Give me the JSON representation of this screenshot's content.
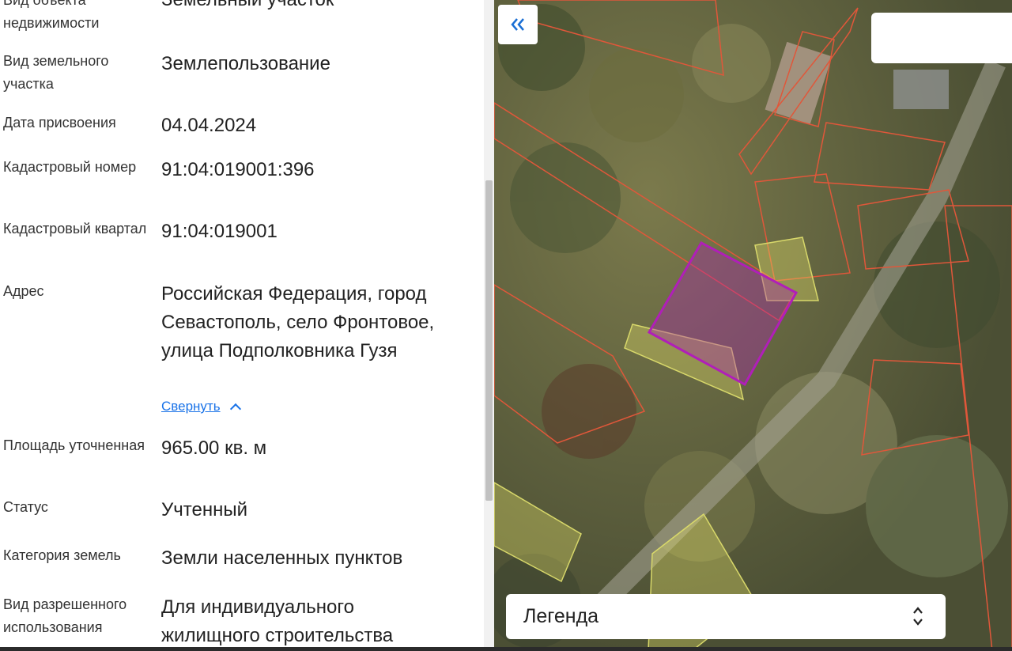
{
  "properties": [
    {
      "label": "Вид объекта недвижимости",
      "value": "Земельный участок"
    },
    {
      "label": "Вид земельного участка",
      "value": "Землепользование"
    },
    {
      "label": "Дата присвоения",
      "value": "04.04.2024"
    },
    {
      "label": "Кадастровый номер",
      "value": "91:04:019001:396"
    },
    {
      "label": "Кадастровый квартал",
      "value": "91:04:019001"
    },
    {
      "label": "Адрес",
      "value": "Российская Федерация, город Севастополь, село Фронтовое, улица Подполковника Гузя"
    },
    {
      "label": "Площадь уточненная",
      "value": "965.00 кв. м"
    },
    {
      "label": "Статус",
      "value": "Учтенный"
    },
    {
      "label": "Категория земель",
      "value": "Земли населенных пунктов"
    },
    {
      "label": "Вид разрешенного использования",
      "value": "Для индивидуального жилищного строительства"
    }
  ],
  "address_collapse_label": "Свернуть",
  "map": {
    "legend_label": "Легенда",
    "collapse_icon": "double-chevron-left-icon",
    "legend_icon": "up-down-chevron-icon",
    "highlight_color": "#b01fb8",
    "parcel_outline_color": "#e0573a",
    "zone_color": "#d8d86a"
  }
}
